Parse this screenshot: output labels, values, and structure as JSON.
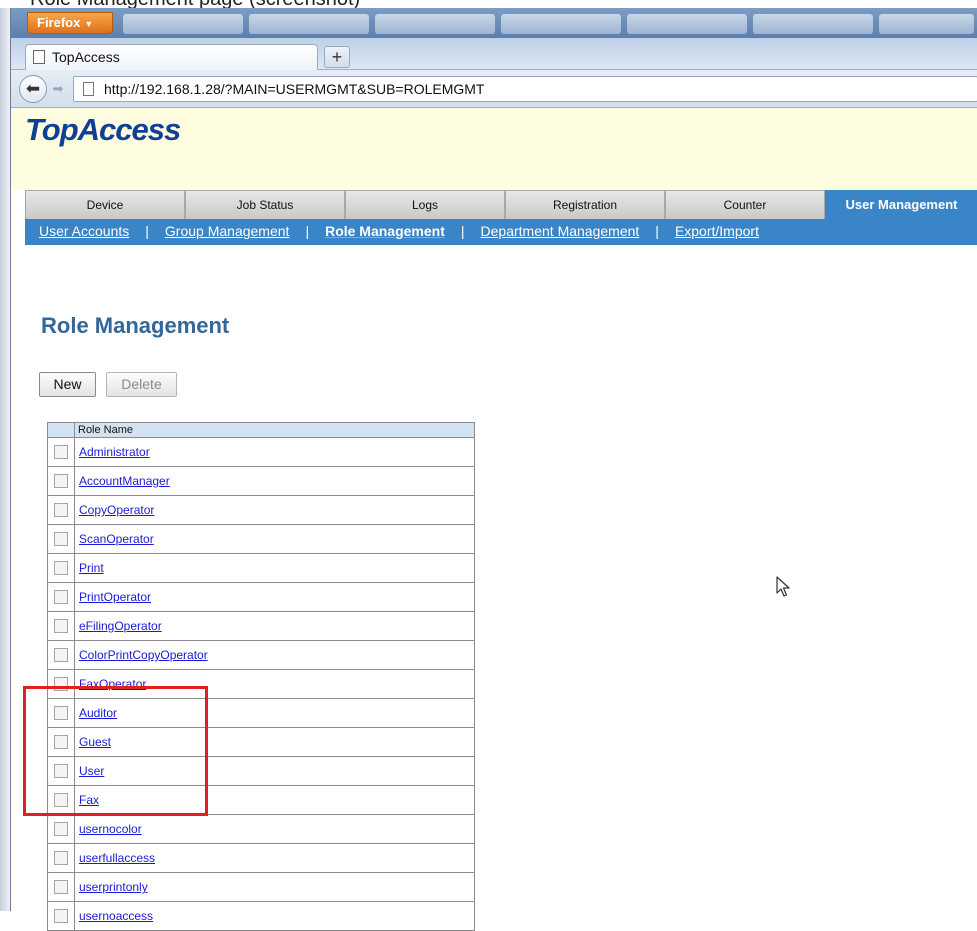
{
  "caption": "Role Management page (screenshot)",
  "browser": {
    "menu_button": "Firefox",
    "tab_title": "TopAccess",
    "new_tab": "+",
    "url": "http://192.168.1.28/?MAIN=USERMGMT&SUB=ROLEMGMT"
  },
  "header": {
    "logo": "TopAccess"
  },
  "main_tabs": [
    {
      "label": "Device"
    },
    {
      "label": "Job Status"
    },
    {
      "label": "Logs"
    },
    {
      "label": "Registration"
    },
    {
      "label": "Counter"
    },
    {
      "label": "User Management",
      "active": true
    }
  ],
  "sub_nav": [
    {
      "label": "User Accounts"
    },
    {
      "label": "Group Management"
    },
    {
      "label": "Role Management",
      "current": true
    },
    {
      "label": "Department Management"
    },
    {
      "label": "Export/Import"
    }
  ],
  "page": {
    "title": "Role Management",
    "new_button": "New",
    "delete_button": "Delete"
  },
  "table": {
    "header": "Role Name",
    "rows": [
      "Administrator",
      "AccountManager",
      "CopyOperator",
      "ScanOperator",
      "Print",
      "PrintOperator",
      "eFilingOperator",
      "ColorPrintCopyOperator",
      "FaxOperator",
      "Auditor",
      "Guest",
      "User",
      "Fax",
      "usernocolor",
      "userfullaccess",
      "userprintonly",
      "usernoaccess"
    ]
  },
  "colors": {
    "accent": "#3a85c7",
    "header_bg": "#fffde0",
    "title": "#336699",
    "highlight": "#e02020"
  }
}
